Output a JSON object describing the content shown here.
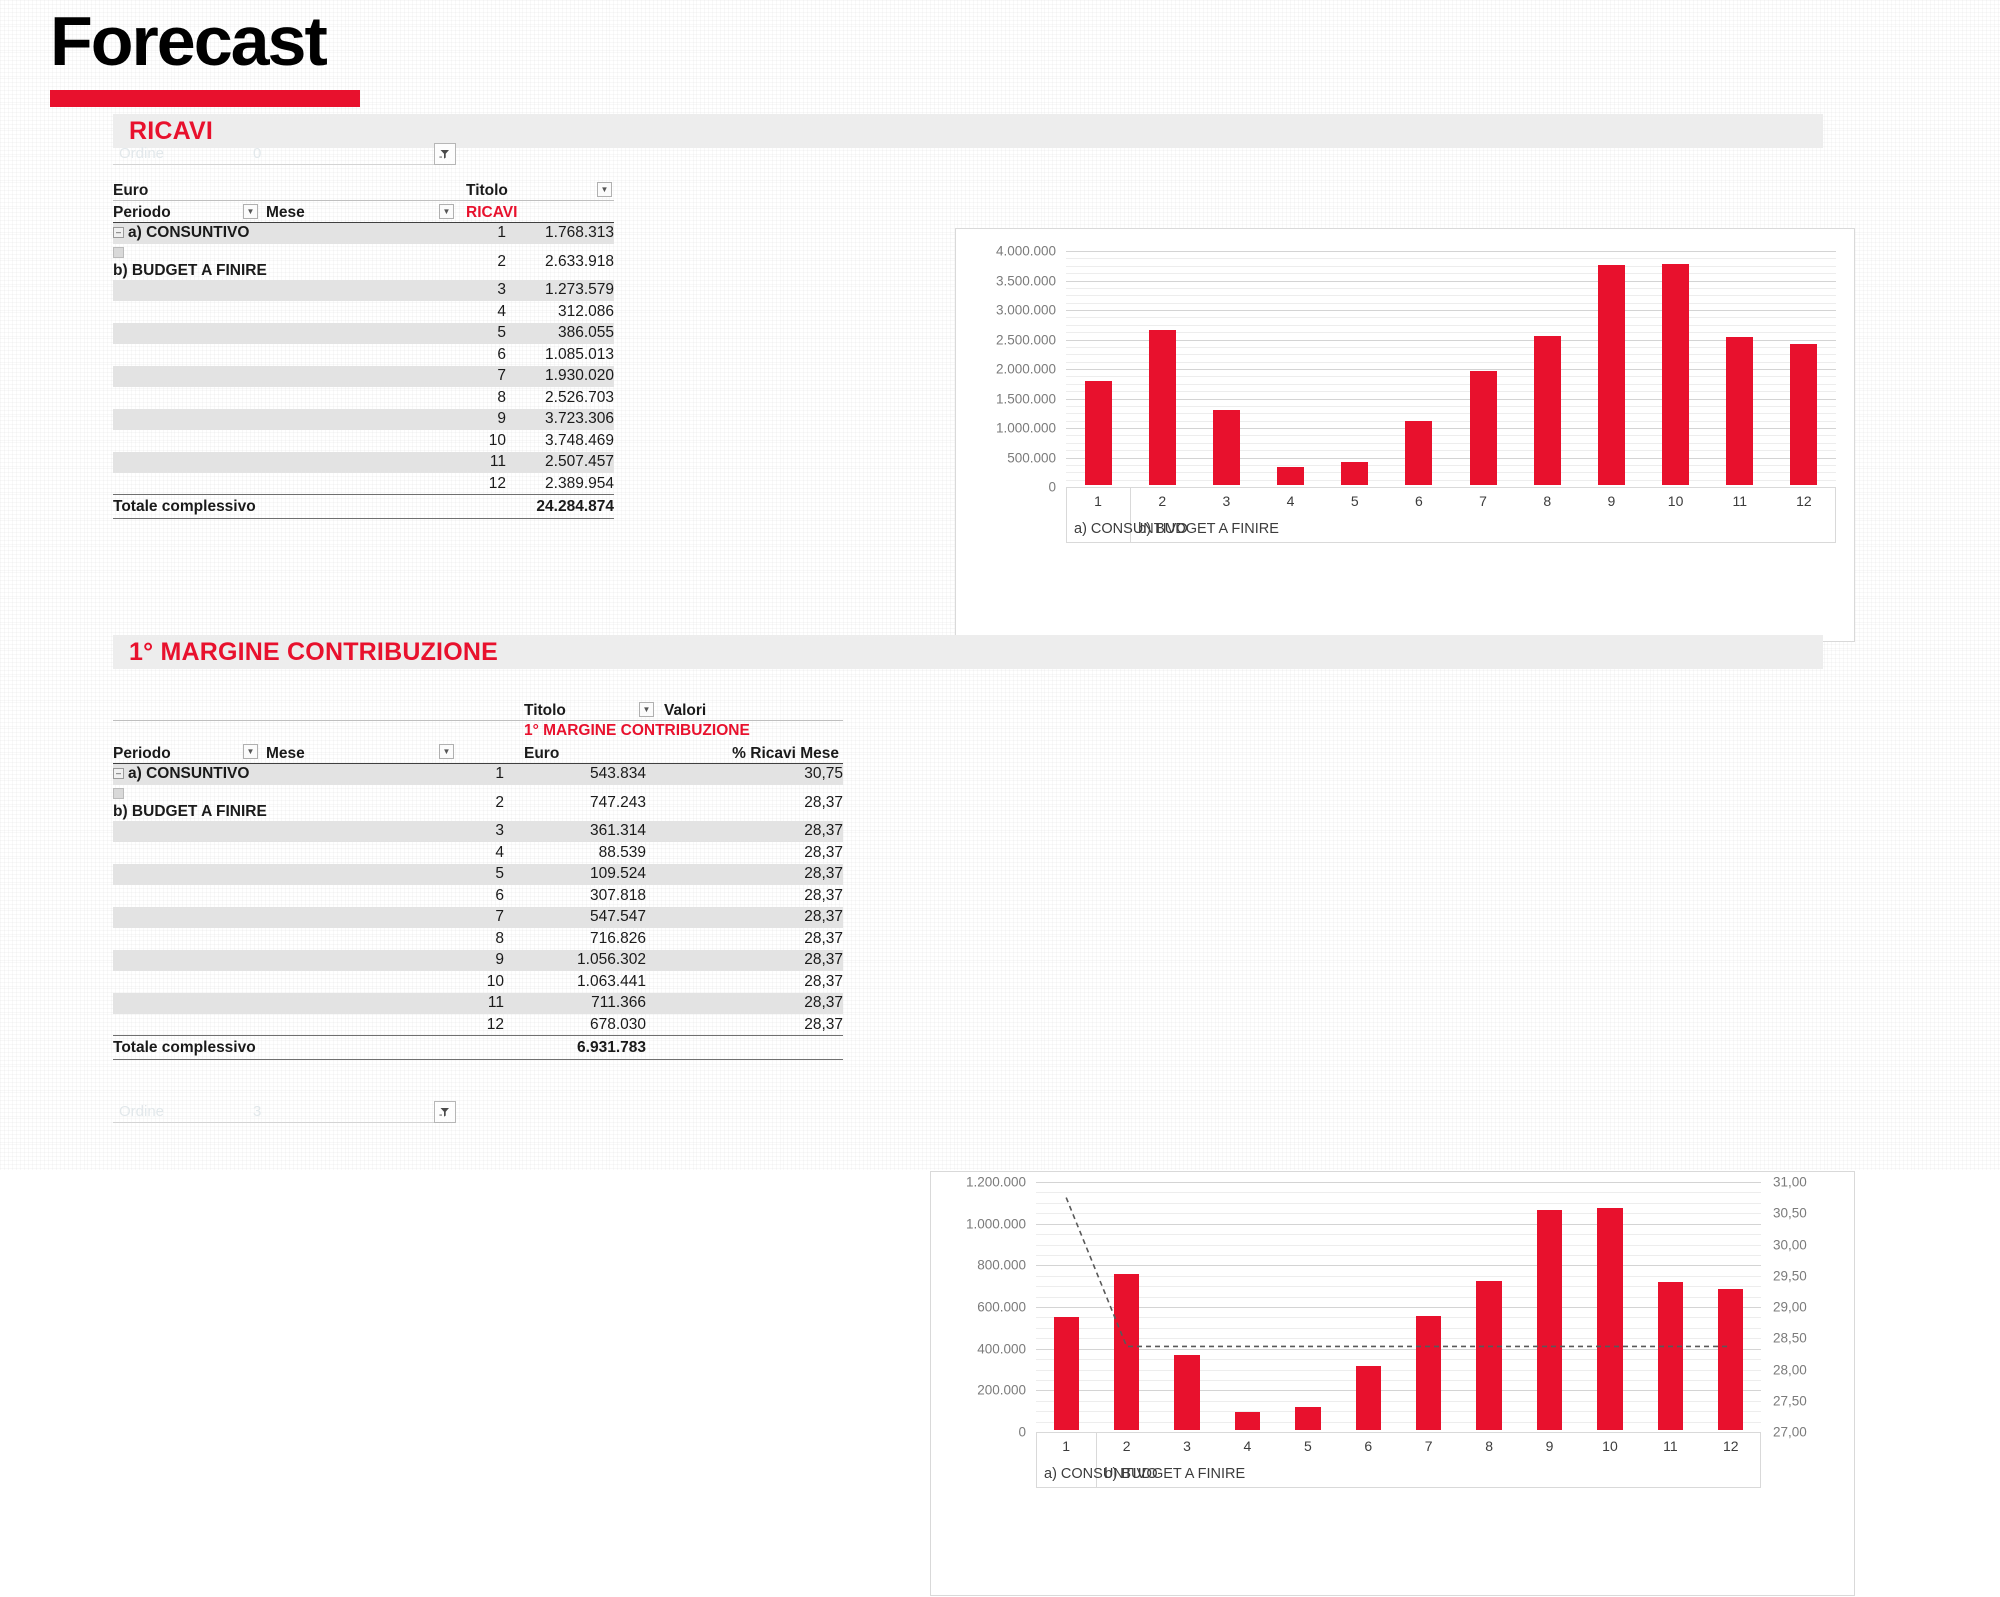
{
  "header": {
    "title": "Forecast",
    "accent_color": "#E8112D"
  },
  "sections": [
    {
      "id": "ricavi",
      "title": "RICAVI",
      "slicer": {
        "label": "Ordine",
        "value": "0",
        "icon": "filter-icon"
      },
      "table": {
        "euro_label": "Euro",
        "titolo_label": "Titolo",
        "measure_label": "RICAVI",
        "col_periodo": "Periodo",
        "col_mese": "Mese",
        "periods": [
          "a) CONSUNTIVO",
          "b) BUDGET A FINIRE"
        ],
        "rows": [
          {
            "mese": "1",
            "euro": "1.768.313"
          },
          {
            "mese": "2",
            "euro": "2.633.918"
          },
          {
            "mese": "3",
            "euro": "1.273.579"
          },
          {
            "mese": "4",
            "euro": "312.086"
          },
          {
            "mese": "5",
            "euro": "386.055"
          },
          {
            "mese": "6",
            "euro": "1.085.013"
          },
          {
            "mese": "7",
            "euro": "1.930.020"
          },
          {
            "mese": "8",
            "euro": "2.526.703"
          },
          {
            "mese": "9",
            "euro": "3.723.306"
          },
          {
            "mese": "10",
            "euro": "3.748.469"
          },
          {
            "mese": "11",
            "euro": "2.507.457"
          },
          {
            "mese": "12",
            "euro": "2.389.954"
          }
        ],
        "total_label": "Totale complessivo",
        "total_value": "24.284.874"
      }
    },
    {
      "id": "margine",
      "title": "1° MARGINE CONTRIBUZIONE",
      "slicer": {
        "label": "Ordine",
        "value": "3",
        "icon": "filter-icon"
      },
      "table": {
        "titolo_label": "Titolo",
        "valori_label": "Valori",
        "measure_label": "1° MARGINE CONTRIBUZIONE",
        "col_periodo": "Periodo",
        "col_mese": "Mese",
        "col_euro": "Euro",
        "col_perc": "% Ricavi Mese",
        "periods": [
          "a) CONSUNTIVO",
          "b) BUDGET A FINIRE"
        ],
        "rows": [
          {
            "mese": "1",
            "euro": "543.834",
            "perc": "30,75"
          },
          {
            "mese": "2",
            "euro": "747.243",
            "perc": "28,37"
          },
          {
            "mese": "3",
            "euro": "361.314",
            "perc": "28,37"
          },
          {
            "mese": "4",
            "euro": "88.539",
            "perc": "28,37"
          },
          {
            "mese": "5",
            "euro": "109.524",
            "perc": "28,37"
          },
          {
            "mese": "6",
            "euro": "307.818",
            "perc": "28,37"
          },
          {
            "mese": "7",
            "euro": "547.547",
            "perc": "28,37"
          },
          {
            "mese": "8",
            "euro": "716.826",
            "perc": "28,37"
          },
          {
            "mese": "9",
            "euro": "1.056.302",
            "perc": "28,37"
          },
          {
            "mese": "10",
            "euro": "1.063.441",
            "perc": "28,37"
          },
          {
            "mese": "11",
            "euro": "711.366",
            "perc": "28,37"
          },
          {
            "mese": "12",
            "euro": "678.030",
            "perc": "28,37"
          }
        ],
        "total_label": "Totale complessivo",
        "total_value": "6.931.783"
      }
    }
  ],
  "chart_data": [
    {
      "id": "chart-ricavi",
      "type": "bar",
      "title": "",
      "xlabel": "",
      "ylabel": "",
      "categories": [
        "1",
        "2",
        "3",
        "4",
        "5",
        "6",
        "7",
        "8",
        "9",
        "10",
        "11",
        "12"
      ],
      "values": [
        1768313,
        2633918,
        1273579,
        312086,
        386055,
        1085013,
        1930020,
        2526703,
        3723306,
        3748469,
        2507457,
        2389954
      ],
      "series": [
        {
          "name": "RICAVI",
          "color": "#E8112D",
          "values": [
            1768313,
            2633918,
            1273579,
            312086,
            386055,
            1085013,
            1930020,
            2526703,
            3723306,
            3748469,
            2507457,
            2389954
          ]
        }
      ],
      "ylim": [
        0,
        4000000
      ],
      "yticks": [
        "0",
        "500.000",
        "1.000.000",
        "1.500.000",
        "2.000.000",
        "2.500.000",
        "3.000.000",
        "3.500.000",
        "4.000.000"
      ],
      "ytick_values": [
        0,
        500000,
        1000000,
        1500000,
        2000000,
        2500000,
        3000000,
        3500000,
        4000000
      ],
      "grid": true,
      "legend_position": "bottom",
      "group_labels": [
        {
          "label": "a) CONSUNTIVO",
          "span": [
            1,
            1
          ]
        },
        {
          "label": "b) BUDGET A FINIRE",
          "span": [
            2,
            12
          ]
        }
      ]
    },
    {
      "id": "chart-margine",
      "type": "bar",
      "title": "",
      "xlabel": "",
      "ylabel": "",
      "categories": [
        "1",
        "2",
        "3",
        "4",
        "5",
        "6",
        "7",
        "8",
        "9",
        "10",
        "11",
        "12"
      ],
      "series": [
        {
          "name": "1° MARGINE CONTRIBUZIONE",
          "type": "bar",
          "axis": "left",
          "color": "#E8112D",
          "values": [
            543834,
            747243,
            361314,
            88539,
            109524,
            307818,
            547547,
            716826,
            1056302,
            1063441,
            711366,
            678030
          ]
        },
        {
          "name": "% Ricavi Mese",
          "type": "line",
          "axis": "right",
          "color": "#595959",
          "dashed": true,
          "values": [
            30.75,
            28.37,
            28.37,
            28.37,
            28.37,
            28.37,
            28.37,
            28.37,
            28.37,
            28.37,
            28.37,
            28.37
          ]
        }
      ],
      "ylim": [
        0,
        1200000
      ],
      "yticks": [
        "0",
        "200.000",
        "400.000",
        "600.000",
        "800.000",
        "1.000.000",
        "1.200.000"
      ],
      "ytick_values": [
        0,
        200000,
        400000,
        600000,
        800000,
        1000000,
        1200000
      ],
      "y2lim": [
        27.0,
        31.0
      ],
      "y2ticks": [
        "27,00",
        "27,50",
        "28,00",
        "28,50",
        "29,00",
        "29,50",
        "30,00",
        "30,50",
        "31,00"
      ],
      "y2tick_values": [
        27.0,
        27.5,
        28.0,
        28.5,
        29.0,
        29.5,
        30.0,
        30.5,
        31.0
      ],
      "grid": true,
      "legend_position": "bottom",
      "group_labels": [
        {
          "label": "a) CONSUNTIVO",
          "span": [
            1,
            1
          ]
        },
        {
          "label": "b) BUDGET A FINIRE",
          "span": [
            2,
            12
          ]
        }
      ]
    }
  ]
}
